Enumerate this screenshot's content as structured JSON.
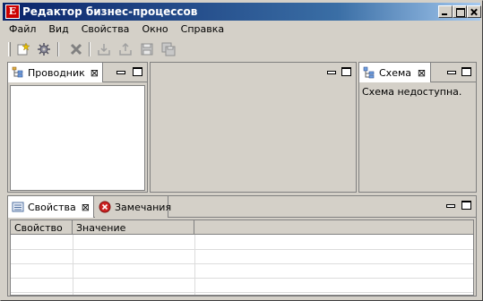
{
  "window": {
    "icon_letter": "E",
    "title": "Редактор бизнес-процессов"
  },
  "menu": [
    "Файл",
    "Вид",
    "Свойства",
    "Окно",
    "Справка"
  ],
  "toolbar": {
    "icons": [
      "new-process-icon",
      "settings-icon",
      "delete-icon",
      "import-icon",
      "export-icon",
      "save-icon",
      "save-all-icon"
    ]
  },
  "explorer": {
    "tab_label": "Проводник"
  },
  "schema": {
    "tab_label": "Схема",
    "message": "Схема недоступна."
  },
  "bottom": {
    "properties_tab": "Свойства",
    "notes_tab": "Замечания",
    "columns": [
      "Свойство",
      "Значение",
      ""
    ],
    "rows": [
      [
        "",
        "",
        ""
      ],
      [
        "",
        "",
        ""
      ],
      [
        "",
        "",
        ""
      ],
      [
        "",
        "",
        ""
      ]
    ]
  },
  "colors": {
    "title_start": "#0a246a",
    "title_end": "#a6caf0",
    "window_bg": "#d4d0c8",
    "error_red": "#cc2222"
  }
}
